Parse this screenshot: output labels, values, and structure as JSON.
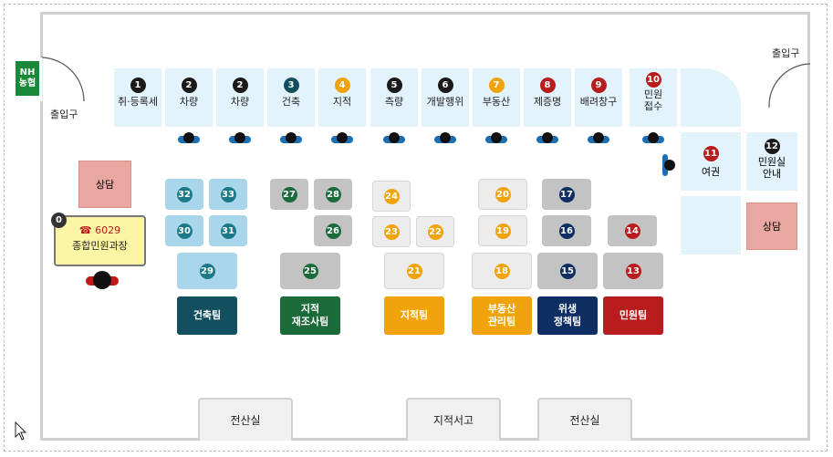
{
  "nh_badge": "NH\n농협",
  "entrances": {
    "left": "출입구",
    "right": "출입구"
  },
  "consult": {
    "left": "상담",
    "right": "상담"
  },
  "manager": {
    "num": "0",
    "phone": "☎ 6029",
    "title": "종합민원과장"
  },
  "windows": [
    {
      "num": "1",
      "label": "취·등록세",
      "color": "#1a1a1a"
    },
    {
      "num": "2",
      "label": "차량",
      "color": "#1a1a1a"
    },
    {
      "num": "2",
      "label": "차량",
      "color": "#1a1a1a"
    },
    {
      "num": "3",
      "label": "건축",
      "color": "#13505f"
    },
    {
      "num": "4",
      "label": "지적",
      "color": "#f0a30a"
    },
    {
      "num": "5",
      "label": "측량",
      "color": "#1a1a1a"
    },
    {
      "num": "6",
      "label": "개발행위",
      "color": "#1a1a1a"
    },
    {
      "num": "7",
      "label": "부동산",
      "color": "#f0a30a"
    },
    {
      "num": "8",
      "label": "제증명",
      "color": "#b81c1c"
    },
    {
      "num": "9",
      "label": "배려창구",
      "color": "#b81c1c"
    },
    {
      "num": "10",
      "label": "민원\n접수",
      "color": "#b81c1c"
    }
  ],
  "side_windows": [
    {
      "num": "11",
      "label": "여권",
      "color": "#b81c1c"
    },
    {
      "num": "12",
      "label": "민원실\n안내",
      "color": "#1a1a1a"
    }
  ],
  "desks": {
    "building": [
      "32",
      "33",
      "30",
      "31",
      "29"
    ],
    "cadastral_survey": [
      "27",
      "28",
      "26",
      "25"
    ],
    "cadastral": [
      "24",
      "23",
      "22",
      "21"
    ],
    "realestate": [
      "20",
      "19",
      "18"
    ],
    "hygiene": [
      "17",
      "16",
      "15"
    ],
    "civil": [
      "14",
      "13"
    ]
  },
  "desk_colors": {
    "building": "#1a7a8a",
    "cadastral_survey": "#1a6a3a",
    "cadastral": "#f0a30a",
    "realestate": "#f0a30a",
    "hygiene": "#0f2f63",
    "civil": "#b81c1c"
  },
  "teams": {
    "building": "건축팀",
    "cadastral_survey": "지적\n재조사팀",
    "cadastral": "지적팀",
    "realestate": "부동산\n관리팀",
    "hygiene": "위생\n정책팀",
    "civil": "민원팀"
  },
  "team_colors": {
    "building": "#13505f",
    "cadastral_survey": "#1a6a3a",
    "cadastral": "#f0a30a",
    "realestate": "#f0a30a",
    "hygiene": "#0f2f63",
    "civil": "#b81c1c"
  },
  "rooms": [
    "전산실",
    "지적서고",
    "전산실"
  ]
}
